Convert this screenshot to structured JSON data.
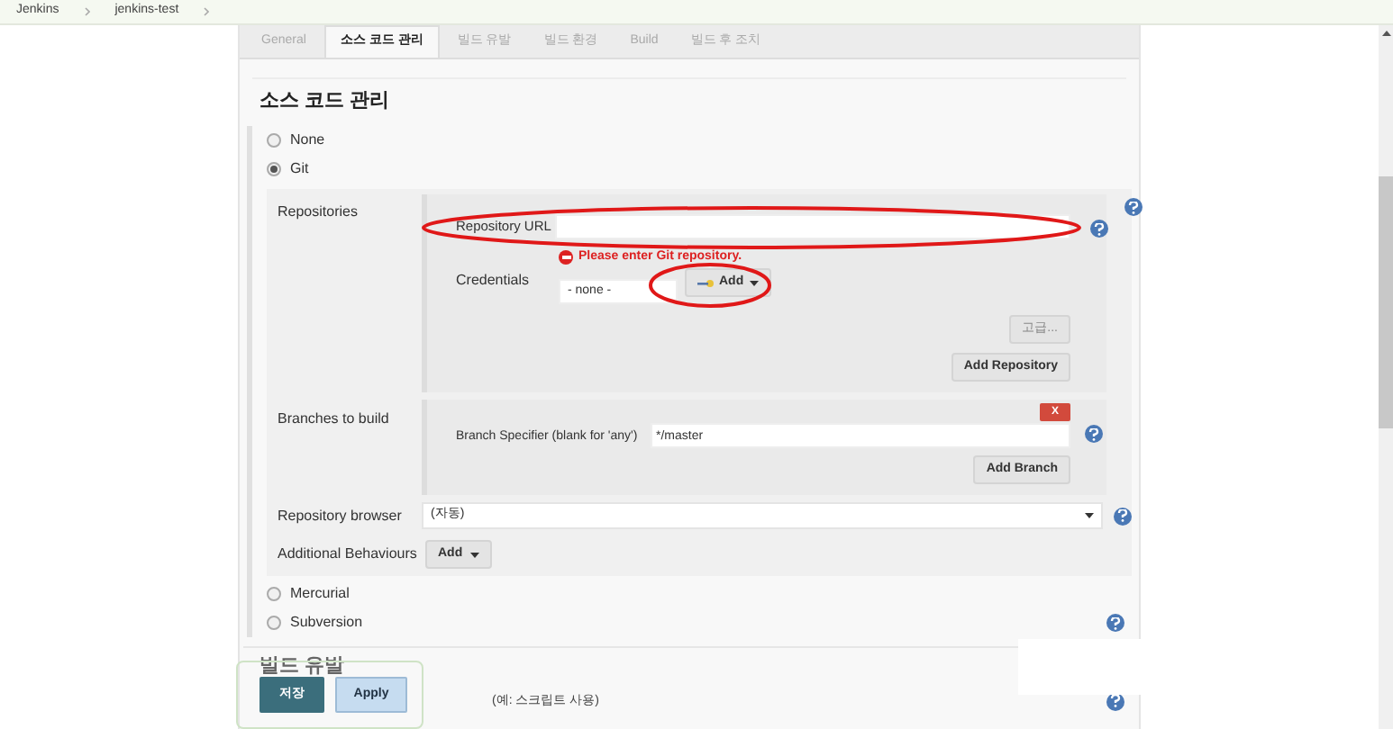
{
  "breadcrumbs": [
    "Jenkins",
    "jenkins-test"
  ],
  "tabs": [
    {
      "label": "General",
      "selected": false
    },
    {
      "label": "소스 코드 관리",
      "selected": true
    },
    {
      "label": "빌드 유발",
      "selected": false
    },
    {
      "label": "빌드 환경",
      "selected": false
    },
    {
      "label": "Build",
      "selected": false
    },
    {
      "label": "빌드 후 조치",
      "selected": false
    }
  ],
  "section_title": "소스 코드 관리",
  "scm_options": [
    {
      "label": "None",
      "selected": false
    },
    {
      "label": "Git",
      "selected": true
    },
    {
      "label": "Mercurial",
      "selected": false
    },
    {
      "label": "Subversion",
      "selected": false
    }
  ],
  "git": {
    "repositories_label": "Repositories",
    "url_label": "Repository URL",
    "url_error": "Please enter Git repository.",
    "credentials_label": "Credentials",
    "credentials_value": "- none -",
    "add_credentials": "Add",
    "advanced_button": "고급...",
    "add_repository": "Add Repository",
    "branches_label": "Branches to build",
    "delete_button": "X",
    "branch_label": "Branch Specifier (blank for 'any')",
    "branch_value": "*/master",
    "add_branch": "Add Branch",
    "browser_label": "Repository browser",
    "browser_value": "(자동)",
    "behaviours_label": "Additional Behaviours",
    "behaviours_add": "Add"
  },
  "next_section_title": "빌드 유발",
  "next_option": "(예: 스크립트 사용)",
  "buttons": {
    "save": "저장",
    "apply": "Apply"
  }
}
